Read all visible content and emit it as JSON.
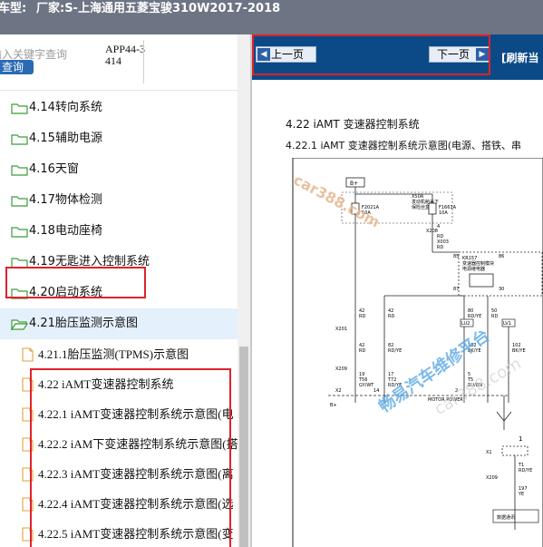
{
  "header": {
    "vehicle_label": "车型:",
    "manufacturer_text": "厂家:S-上海通用五菱宝骏310W2017-2018"
  },
  "search": {
    "placeholder": "输入关键字查询",
    "button_label": "查询",
    "code": "APP44-3414"
  },
  "tree": {
    "folders": [
      {
        "label": "4.14转向系统"
      },
      {
        "label": "4.15辅助电源"
      },
      {
        "label": "4.16天窗"
      },
      {
        "label": "4.17物体检测"
      },
      {
        "label": "4.18电动座椅"
      },
      {
        "label": "4.19无匙进入控制系统"
      },
      {
        "label": "4.20启动系统"
      },
      {
        "label": "4.21胎压监测示意图"
      }
    ],
    "documents": [
      {
        "label": "4.21.1胎压监测(TPMS)示意图"
      },
      {
        "label": "4.22 iAMT变速器控制系统"
      },
      {
        "label": "4.22.1 iAMT变速器控制系统示意图(电"
      },
      {
        "label": "4.22.2 iAM下变速器控制系统示意图(搭"
      },
      {
        "label": "4.22.3 iAMT变速器控制系统示意图(离"
      },
      {
        "label": "4.22.4 iAMT变速器控制系统示意图(选"
      },
      {
        "label": "4.22.5 iAMT变速器控制系统示意图(变"
      }
    ]
  },
  "nav": {
    "prev_label": "上一页",
    "next_label": "下一页",
    "refresh_label": "[刷新当"
  },
  "document": {
    "section_title": "4.22 iAMT 变速器控制系统",
    "subsection_title": "4.22.1 iAMT 变速器控制系统示意图(电源、搭铁、串",
    "watermark_url": "car388.com",
    "watermark_cn": "畅易汽车维修平台",
    "watermark_faint": "car388.com",
    "diagram_labels": {
      "bplus": "B+",
      "x50a": "X50A",
      "fuse_block_1": "发动机舱盖下",
      "fuse_block_2": "保险丝盒",
      "fuse_left": "F2021A",
      "fuse_left_amp": "10A",
      "fuse_right": "F1661A",
      "fuse_right_amp": "10A",
      "conn_x208": "X208",
      "wire_left_a": "4",
      "wire_left_b": "RD",
      "splice_a": "X003",
      "splice_a_color": "RD",
      "relay_id": "KR157",
      "relay_text_1": "变速器控制模块",
      "relay_text_2": "电源继电器",
      "pin_85": "85",
      "pin_86": "86",
      "pin_87": "87",
      "pin_30": "30",
      "wire_l1": "42",
      "wire_l1_c": "RD",
      "wire_m1": "42",
      "wire_m1_c": "RD",
      "wire_r1": "80",
      "wire_r1_c": "RD/YE",
      "wire_r2": "50",
      "wire_r2_c": "RD",
      "conn_x201": "X201",
      "lu2": "LU2",
      "lv1": "LV1",
      "wire_l2": "42",
      "wire_l2_c": "RD",
      "wire_m2": "82",
      "wire_m2_c": "RD/YE",
      "wire_r3": "102",
      "wire_r3_c": "BK/YE",
      "wire_r4": "102",
      "wire_r4_c": "BK/YE",
      "conn_x209": "X209",
      "pin_19": "19",
      "pin_19_c": "T56",
      "pin_19_w": "GY/WT",
      "pin_17": "17",
      "pin_17_c": "T72",
      "pin_17_w": "RD/YE",
      "pin_5": "5",
      "pin_5_c": "T5",
      "pin_5_w": "BU/BN",
      "conn_x2": "X2",
      "pin_14": "14",
      "pin_2": "2",
      "motor_power": "MOTOR POWER",
      "module_bplus": "B+",
      "x1": "X1",
      "pin_t1": "T1",
      "pin_t1_w": "RD/YE",
      "pin_197": "197",
      "pin_197_w": "YE",
      "conn_x209b": "X209",
      "data_link": "数据通讯",
      "side_label": "1"
    }
  }
}
